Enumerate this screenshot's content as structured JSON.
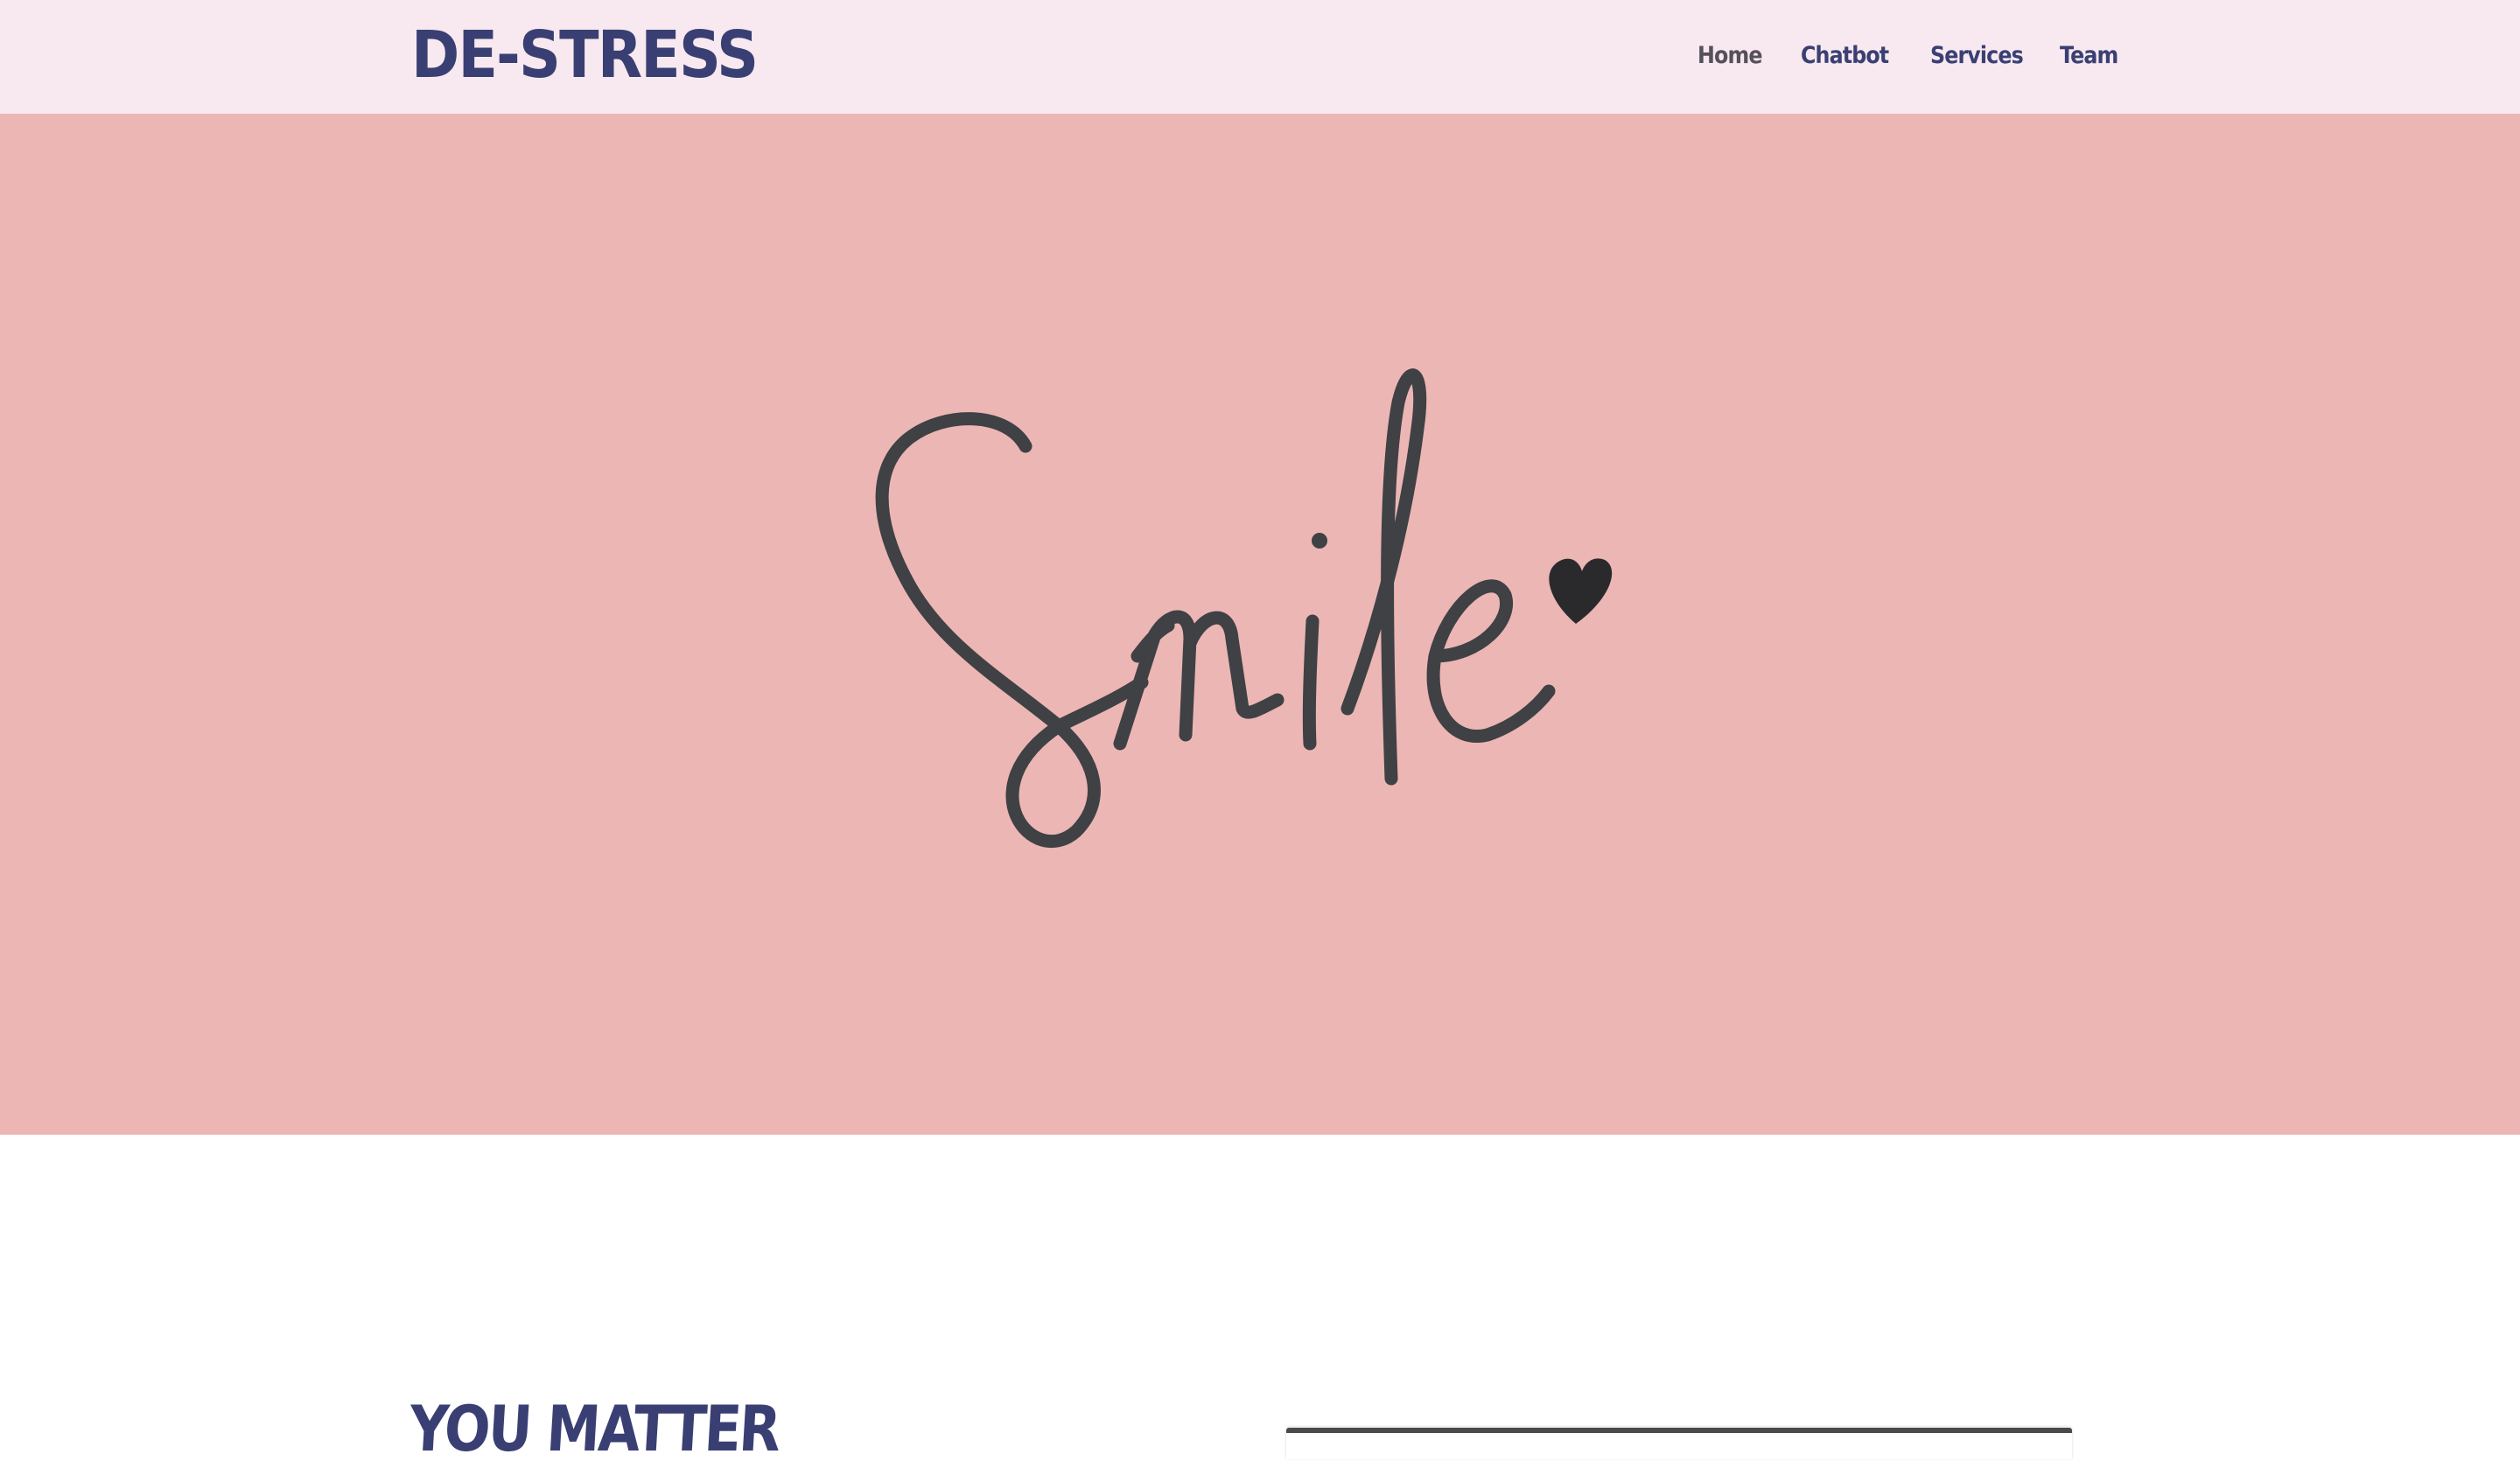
{
  "brand": {
    "logo_text": "DE-STRESS"
  },
  "nav": {
    "items": [
      {
        "label": "Home",
        "active": true
      },
      {
        "label": "Chatbot",
        "active": false
      },
      {
        "label": "Services",
        "active": false
      },
      {
        "label": "Team",
        "active": false
      }
    ]
  },
  "hero": {
    "image_text": "Smile",
    "image_icon": "heart-icon",
    "background": "#ecb6b5"
  },
  "section": {
    "heading": "YOU MATTER"
  },
  "colors": {
    "brand": "#3a3f73",
    "navbar_bg": "#f7e9ef",
    "nav_active": "#555059"
  }
}
